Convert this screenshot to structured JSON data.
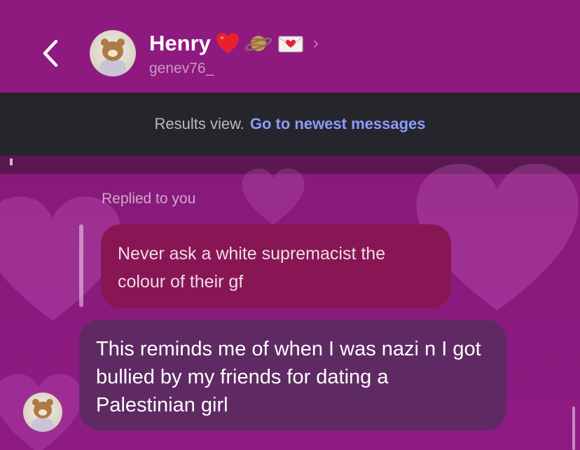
{
  "header": {
    "name": "Henry",
    "username": "genev76_",
    "name_emojis": [
      "red-heart",
      "ringed-planet",
      "love-letter"
    ]
  },
  "banner": {
    "static_text": "Results view.",
    "link_text": "Go to newest messages"
  },
  "conversation": {
    "replied_label": "Replied to you",
    "quoted_message": "Never ask a white supremacist the colour of their gf",
    "message": "This reminds me of when I was nazi n I got bullied by my friends for dating a Palestinian girl"
  },
  "colors": {
    "header_bg": "#8e1a80",
    "banner_bg": "#26252b",
    "link": "#8c9bff",
    "quoted_bubble": "#891654",
    "message_bubble": "#5f2a63"
  }
}
